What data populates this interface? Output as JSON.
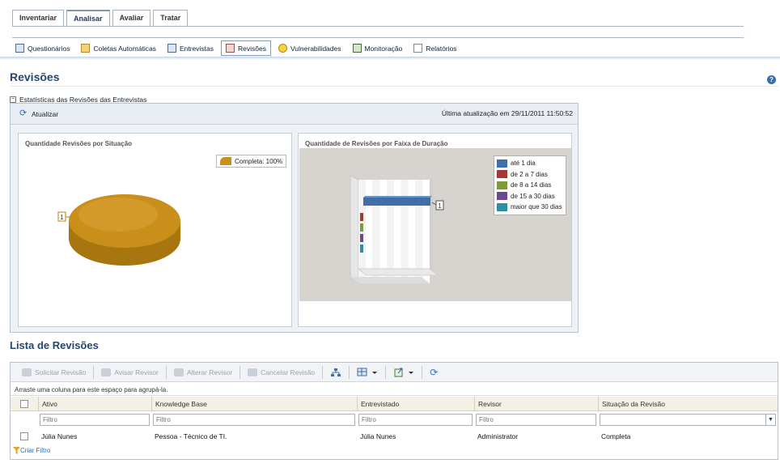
{
  "main_tabs": [
    {
      "label": "Inventariar"
    },
    {
      "label": "Analisar"
    },
    {
      "label": "Avaliar"
    },
    {
      "label": "Tratar"
    }
  ],
  "sub_tabs": [
    {
      "label": "Questionários",
      "icon": "questionnaire-icon"
    },
    {
      "label": "Coletas Automáticas",
      "icon": "automatic-collection-icon"
    },
    {
      "label": "Entrevistas",
      "icon": "interview-icon"
    },
    {
      "label": "Revisões",
      "icon": "review-icon"
    },
    {
      "label": "Vulnerabilidades",
      "icon": "vulnerability-icon"
    },
    {
      "label": "Monitoração",
      "icon": "monitoring-icon"
    },
    {
      "label": "Relatórios",
      "icon": "reports-icon"
    }
  ],
  "page": {
    "title": "Revisões",
    "help": "?"
  },
  "stats": {
    "section_title": "Estatísticas das Revisões das Entrevistas",
    "refresh_label": "Atualizar",
    "last_update": "Última atualização em 29/11/2011 11:50:52"
  },
  "chart_data": [
    {
      "type": "pie",
      "title": "Quantidade Revisões por Situação",
      "slices": [
        {
          "name": "Completa: 100%",
          "value": 1
        }
      ],
      "data_label": "1",
      "colors": [
        "#c98f1a"
      ],
      "legend": "top-right"
    },
    {
      "type": "bar",
      "title": "Quantidade de Revisões por Faixa de Duração",
      "series": [
        {
          "name": "até 1 dia",
          "values": [
            1
          ],
          "color": "#3f6ea8"
        },
        {
          "name": "de 2 a 7 dias",
          "values": [
            0
          ],
          "color": "#a33a3a"
        },
        {
          "name": "de 8 a 14 dias",
          "values": [
            0
          ],
          "color": "#7e9a3a"
        },
        {
          "name": "de 15 a 30 dias",
          "values": [
            0
          ],
          "color": "#6a4a8c"
        },
        {
          "name": "maior que 30 dias",
          "values": [
            0
          ],
          "color": "#2f8ea0"
        }
      ],
      "data_label": "1",
      "legend": "top-right"
    }
  ],
  "list": {
    "title": "Lista de Revisões",
    "toolbar": {
      "request": "Solicitar Revisão",
      "notify": "Avisar Revisor",
      "change": "Alterar Revisor",
      "cancel": "Cancelar Revisão"
    },
    "group_hint": "Arraste uma coluna para este espaço para agrupá-la.",
    "columns": [
      "Ativo",
      "Knowledge Base",
      "Entrevistado",
      "Revisor",
      "Situação da Revisão"
    ],
    "filter_placeholder": "Filtro",
    "rows": [
      {
        "ativo": "Júlia Nunes",
        "kb": "Pessoa - Técnico de TI.",
        "entrevistado": "Júlia Nunes",
        "revisor": "Administrator",
        "situacao": "Completa"
      }
    ],
    "create_filter": "Criar Filtro"
  }
}
